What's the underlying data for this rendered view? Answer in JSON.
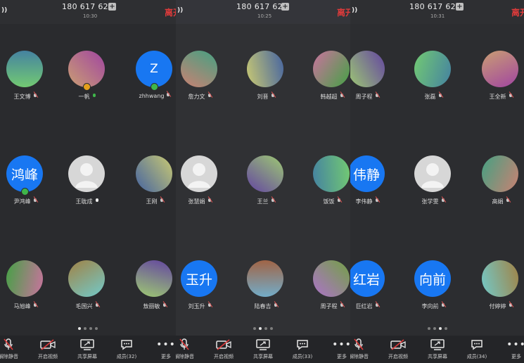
{
  "panels": [
    {
      "phone": "180 617 623",
      "time": "10:30",
      "leave": "离开",
      "participants": [
        {
          "name": "王文博",
          "avatar": "photo",
          "mic": "muted"
        },
        {
          "name": "一帆",
          "avatar": "photo",
          "mic": "on",
          "badge": "orange"
        },
        {
          "name": "zhhwang",
          "avatar": "initial",
          "initial": "Z",
          "mic": "muted",
          "badge": "green"
        },
        {
          "name": "尹鸿峰",
          "avatar": "initial",
          "initial": "鸿峰",
          "mic": "muted",
          "badge": "green"
        },
        {
          "name": "王耽成",
          "avatar": "default",
          "mic": "mic"
        },
        {
          "name": "王刚",
          "avatar": "photo",
          "mic": "muted"
        },
        {
          "name": "马旭峰",
          "avatar": "photo",
          "mic": "muted"
        },
        {
          "name": "毛国兴",
          "avatar": "photo",
          "mic": "muted"
        },
        {
          "name": "敖丽敏",
          "avatar": "photo",
          "mic": "muted"
        }
      ],
      "dots": 4,
      "active_dot": 0,
      "toolbar": {
        "mute": "解除静音",
        "video": "开启视频",
        "share": "共享屏幕",
        "members": "成员(32)",
        "more": "更多"
      }
    },
    {
      "phone": "180 617 623",
      "time": "10:25",
      "leave": "离开",
      "participants": [
        {
          "name": "詹力文",
          "avatar": "photo",
          "mic": "muted"
        },
        {
          "name": "刘晋",
          "avatar": "photo",
          "mic": "muted"
        },
        {
          "name": "韩越超",
          "avatar": "photo",
          "mic": "muted"
        },
        {
          "name": "张慧娟",
          "avatar": "default",
          "mic": "muted"
        },
        {
          "name": "王兰",
          "avatar": "photo",
          "mic": "muted"
        },
        {
          "name": "饭饭",
          "avatar": "photo",
          "mic": "muted"
        },
        {
          "name": "刘玉升",
          "avatar": "initial",
          "initial": "玉升",
          "mic": "muted"
        },
        {
          "name": "陆春吉",
          "avatar": "photo",
          "mic": "muted"
        },
        {
          "name": "周子程",
          "avatar": "photo",
          "mic": "muted"
        }
      ],
      "dots": 4,
      "active_dot": 1,
      "toolbar": {
        "mute": "解除静音",
        "video": "开启视频",
        "share": "共享屏幕",
        "members": "成员(33)",
        "more": "更多"
      }
    },
    {
      "phone": "180 617 623",
      "time": "10:31",
      "leave": "离开",
      "participants": [
        {
          "name": "周子程",
          "avatar": "photo",
          "mic": "muted"
        },
        {
          "name": "张磊",
          "avatar": "photo",
          "mic": "muted"
        },
        {
          "name": "王全新",
          "avatar": "photo",
          "mic": "muted"
        },
        {
          "name": "李伟静",
          "avatar": "initial",
          "initial": "伟静",
          "mic": "muted"
        },
        {
          "name": "张学雯",
          "avatar": "default",
          "mic": "muted"
        },
        {
          "name": "高娟",
          "avatar": "photo",
          "mic": "muted"
        },
        {
          "name": "巨红岩",
          "avatar": "initial",
          "initial": "红岩",
          "mic": "muted"
        },
        {
          "name": "李向前",
          "avatar": "initial",
          "initial": "向前",
          "mic": "muted"
        },
        {
          "name": "付婷婷",
          "avatar": "photo",
          "mic": "muted"
        }
      ],
      "dots": 4,
      "active_dot": 2,
      "toolbar": {
        "mute": "解除静音",
        "video": "开启视频",
        "share": "共享屏幕",
        "members": "成员(34)",
        "more": "更多"
      }
    }
  ],
  "colors": {
    "accent_blue": "#1877f2",
    "leave_red": "#e03b3b",
    "mic_on_green": "#3fb64a",
    "background": "#2b2c2f"
  }
}
